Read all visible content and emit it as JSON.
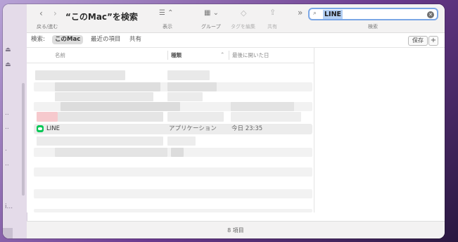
{
  "toolbar": {
    "nav_label": "戻る/進む",
    "title": "“このMac”を検索",
    "view_label": "表示",
    "group_label": "グループ",
    "tag_label": "タグを編集",
    "share_label": "共有",
    "search_label": "検索",
    "more_glyph": "»"
  },
  "search": {
    "value": "LINE"
  },
  "scope": {
    "label": "検索:",
    "options": [
      "このMac",
      "最近の項目",
      "共有"
    ],
    "selected": "このMac",
    "save_label": "保存",
    "add_label": "+"
  },
  "columns": {
    "name": "名前",
    "kind": "種類",
    "last_opened": "最後に開いた日"
  },
  "result": {
    "name": "LINE",
    "kind": "アプリケーション",
    "last_opened": "今日 23:35"
  },
  "status": {
    "count_text": "8 項目"
  },
  "colors": {
    "accent": "#7aa6e6",
    "line_green": "#06c755"
  }
}
